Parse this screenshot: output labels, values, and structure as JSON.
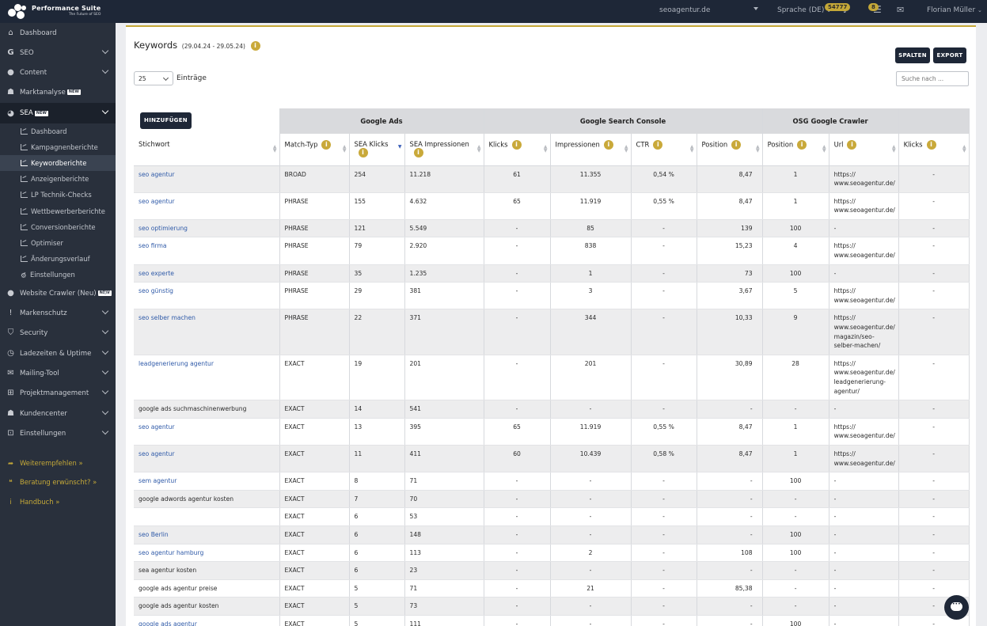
{
  "brand": {
    "name": "Performance Suite",
    "tagline": "The Future of SEO"
  },
  "topbar": {
    "domain": "seoagentur.de",
    "language": "Sprache (DE)",
    "notifications_count": "54777",
    "tasks_count": "8",
    "user": "Florian Müller"
  },
  "sidebar": {
    "items": [
      {
        "label": "Dashboard",
        "icon": "home-icon"
      },
      {
        "label": "SEO",
        "icon": "google-icon"
      },
      {
        "label": "Content",
        "icon": "globe-icon"
      },
      {
        "label": "Marktanalyse",
        "icon": "people-icon",
        "tag": "NEW"
      },
      {
        "label": "SEA",
        "icon": "pie-chart-icon",
        "tag": "NEW"
      },
      {
        "label": "Website Crawler (Neu)",
        "icon": "globe-icon",
        "tag": "NEW"
      },
      {
        "label": "Markenschutz",
        "icon": "exclamation-icon"
      },
      {
        "label": "Security",
        "icon": "shield-icon"
      },
      {
        "label": "Ladezeiten & Uptime",
        "icon": "clock-icon"
      },
      {
        "label": "Mailing-Tool",
        "icon": "mail-icon"
      },
      {
        "label": "Projektmanagement",
        "icon": "sitemap-icon"
      },
      {
        "label": "Kundencenter",
        "icon": "people-icon"
      },
      {
        "label": "Einstellungen",
        "icon": "lock-icon"
      }
    ],
    "sea_sub": [
      "Dashboard",
      "Kampagnenberichte",
      "Keywordberichte",
      "Anzeigenberichte",
      "LP Technik-Checks",
      "Wettbewerberberichte",
      "Conversionberichte",
      "Optimiser",
      "Änderungsverlauf",
      "Einstellungen"
    ],
    "extras": [
      "Weiterempfehlen »",
      "Beratung erwünscht? »",
      "Handbuch »"
    ]
  },
  "page": {
    "title": "Keywords",
    "date_range": "(29.04.24 - 29.05.24)",
    "columns_button": "SPALTEN",
    "export_button": "EXPORT",
    "page_size": "25",
    "entries_label": "Einträge",
    "search_placeholder": "Suche nach ...",
    "add_button": "HINZUFÜGEN"
  },
  "table": {
    "groups": [
      "Google Ads",
      "Google Search Console",
      "OSG Google Crawler"
    ],
    "headers": [
      "Stichwort",
      "Match-Typ",
      "SEA Klicks",
      "SEA Impressionen",
      "Klicks",
      "Impressionen",
      "CTR",
      "Position",
      "Position",
      "Url",
      "Klicks"
    ],
    "rows": [
      [
        "seo agentur",
        "BROAD",
        "254",
        "11.218",
        "61",
        "11.355",
        "0,54 %",
        "8,47",
        "1",
        "https:// www.seoagentur.de/",
        "-"
      ],
      [
        "seo agentur",
        "PHRASE",
        "155",
        "4.632",
        "65",
        "11.919",
        "0,55 %",
        "8,47",
        "1",
        "https:// www.seoagentur.de/",
        "-"
      ],
      [
        "seo optimierung",
        "PHRASE",
        "121",
        "5.549",
        "-",
        "85",
        "-",
        "139",
        "100",
        "-",
        "-"
      ],
      [
        "seo firma",
        "PHRASE",
        "79",
        "2.920",
        "-",
        "838",
        "-",
        "15,23",
        "4",
        "https:// www.seoagentur.de/",
        "-"
      ],
      [
        "seo experte",
        "PHRASE",
        "35",
        "1.235",
        "-",
        "1",
        "-",
        "73",
        "100",
        "-",
        "-"
      ],
      [
        "seo günstig",
        "PHRASE",
        "29",
        "381",
        "-",
        "3",
        "-",
        "3,67",
        "5",
        "https:// www.seoagentur.de/",
        "-"
      ],
      [
        "seo selber machen",
        "PHRASE",
        "22",
        "371",
        "-",
        "344",
        "-",
        "10,33",
        "9",
        "https:// www.seoagentur.de/ magazin/seo- selber-machen/",
        "-"
      ],
      [
        "leadgenerierung agentur",
        "EXACT",
        "19",
        "201",
        "-",
        "201",
        "-",
        "30,89",
        "28",
        "https:// www.seoagentur.de/ leadgenerierung- agentur/",
        "-"
      ],
      [
        "google ads suchmaschinenwerbung",
        "EXACT",
        "14",
        "541",
        "-",
        "-",
        "-",
        "-",
        "-",
        "-",
        "-"
      ],
      [
        "seo agentur",
        "EXACT",
        "13",
        "395",
        "65",
        "11.919",
        "0,55 %",
        "8,47",
        "1",
        "https:// www.seoagentur.de/",
        "-"
      ],
      [
        "seo agentur",
        "EXACT",
        "11",
        "411",
        "60",
        "10.439",
        "0,58 %",
        "8,47",
        "1",
        "https:// www.seoagentur.de/",
        "-"
      ],
      [
        "sem agentur",
        "EXACT",
        "8",
        "71",
        "-",
        "-",
        "-",
        "-",
        "100",
        "-",
        "-"
      ],
      [
        "google adwords agentur kosten",
        "EXACT",
        "7",
        "70",
        "-",
        "-",
        "-",
        "-",
        "-",
        "-",
        "-"
      ],
      [
        "",
        "EXACT",
        "6",
        "53",
        "-",
        "-",
        "-",
        "-",
        "-",
        "-",
        "-"
      ],
      [
        "seo Berlin",
        "EXACT",
        "6",
        "148",
        "-",
        "-",
        "-",
        "-",
        "100",
        "-",
        "-"
      ],
      [
        "seo agentur hamburg",
        "EXACT",
        "6",
        "113",
        "-",
        "2",
        "-",
        "108",
        "100",
        "-",
        "-"
      ],
      [
        "sea agentur kosten",
        "EXACT",
        "6",
        "23",
        "-",
        "-",
        "-",
        "-",
        "-",
        "-",
        "-"
      ],
      [
        "google ads agentur preise",
        "EXACT",
        "5",
        "71",
        "-",
        "21",
        "-",
        "85,38",
        "-",
        "-",
        "-"
      ],
      [
        "google ads agentur kosten",
        "EXACT",
        "5",
        "73",
        "-",
        "-",
        "-",
        "-",
        "-",
        "-",
        "-"
      ],
      [
        "google ads agentur",
        "EXACT",
        "5",
        "111",
        "-",
        "-",
        "-",
        "-",
        "100",
        "-",
        "-"
      ]
    ],
    "linked_rows": [
      0,
      1,
      2,
      3,
      4,
      5,
      6,
      7,
      9,
      10,
      11,
      14,
      15,
      19
    ]
  },
  "colors": {
    "accent": "#c4a838",
    "sidebar": "#29303c",
    "topbar": "#1e2737",
    "link": "#2f5aa8"
  }
}
